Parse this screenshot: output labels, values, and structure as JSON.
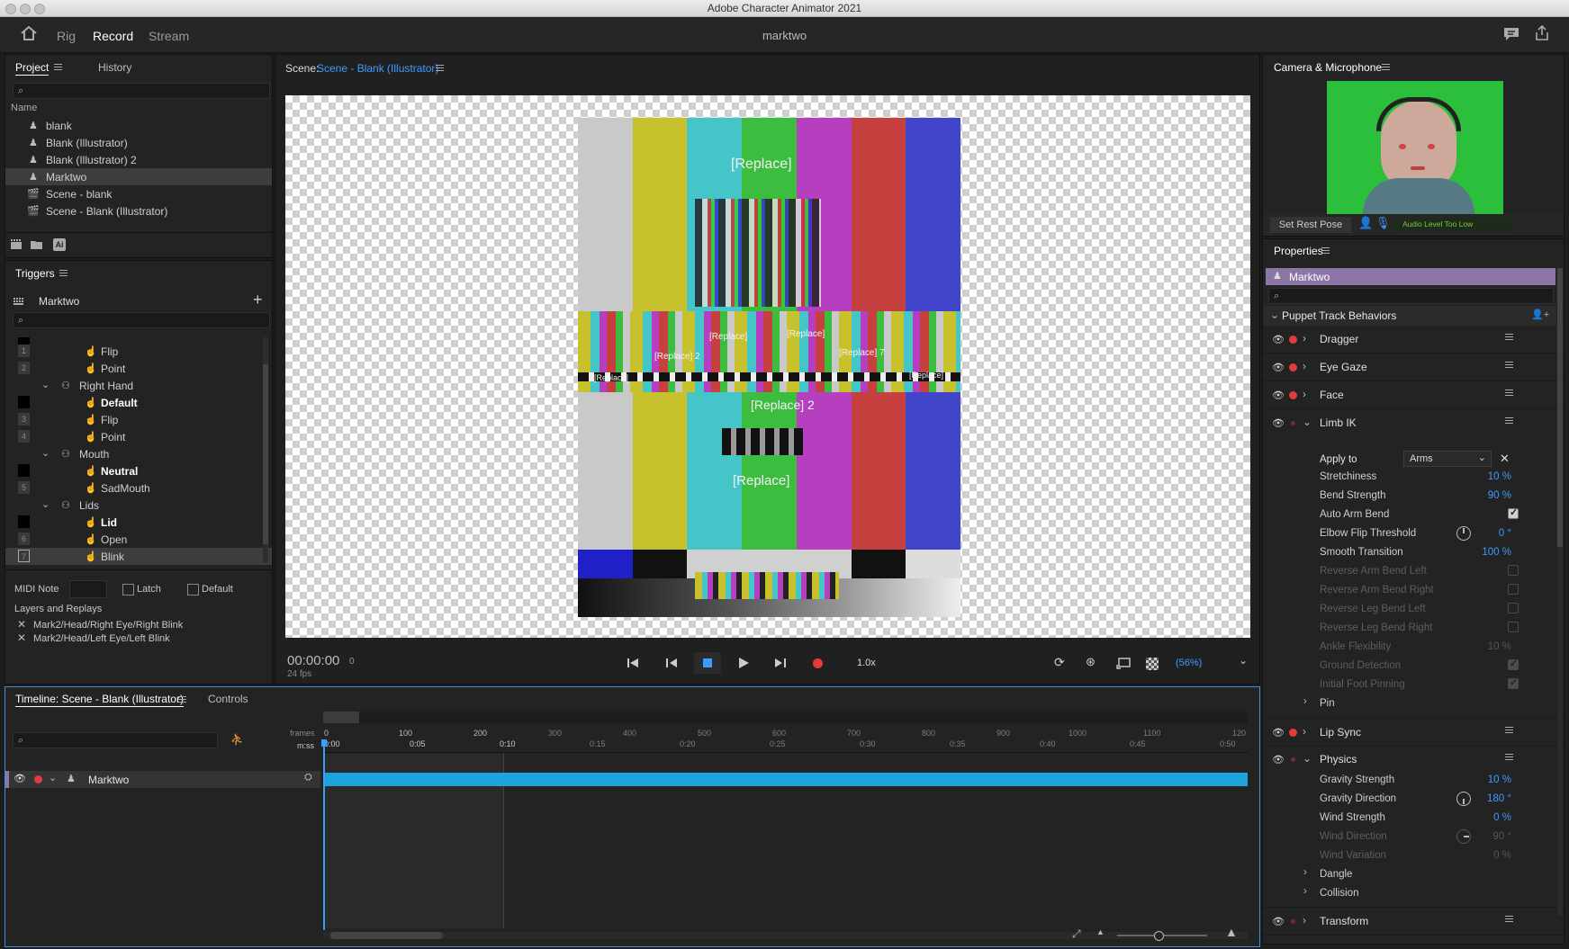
{
  "window": {
    "title": "Adobe Character Animator 2021"
  },
  "modes": {
    "rig": "Rig",
    "record": "Record",
    "stream": "Stream",
    "document_title": "marktwo"
  },
  "project": {
    "tab_project": "Project",
    "tab_history": "History",
    "col_name": "Name",
    "items": [
      "blank",
      "Blank (Illustrator)",
      "Blank (Illustrator) 2",
      "Marktwo",
      "Scene - blank",
      "Scene - Blank (Illustrator)"
    ],
    "ai_badge": "Ai"
  },
  "triggers": {
    "title": "Triggers",
    "puppet": "Marktwo",
    "rows": [
      {
        "num": "1",
        "label": "Flip"
      },
      {
        "num": "2",
        "label": "Point"
      },
      {
        "num": "",
        "label": "Right Hand"
      },
      {
        "num": "",
        "label": "Default"
      },
      {
        "num": "3",
        "label": "Flip"
      },
      {
        "num": "4",
        "label": "Point"
      },
      {
        "num": "",
        "label": "Mouth"
      },
      {
        "num": "",
        "label": "Neutral"
      },
      {
        "num": "5",
        "label": "SadMouth"
      },
      {
        "num": "",
        "label": "Lids"
      },
      {
        "num": "",
        "label": "Lid"
      },
      {
        "num": "6",
        "label": "Open"
      },
      {
        "num": "7",
        "label": "Blink"
      }
    ],
    "midi_note": "MIDI Note",
    "latch": "Latch",
    "default": "Default",
    "layers_title": "Layers and Replays",
    "layers": [
      "Mark2/Head/Right Eye/Right Blink",
      "Mark2/Head/Left Eye/Left Blink"
    ]
  },
  "scene": {
    "label": "Scene:",
    "name": "Scene - Blank (Illustrator)",
    "replace_labels": [
      "[Replace]",
      "[Replace] 2",
      "[Replace]",
      "[Replace]",
      "[Replace]",
      "[Replace] 2",
      "[Replace] 7",
      "[Replace]",
      "[Replace]"
    ],
    "timecode": "00:00:00",
    "frame": "0",
    "fps": "24 fps",
    "speed": "1.0x",
    "zoom": "(56%)"
  },
  "camera": {
    "title": "Camera & Microphone",
    "rest_pose": "Set Rest Pose",
    "audio_status": "Audio Level Too Low"
  },
  "properties": {
    "title": "Properties",
    "puppet": "Marktwo",
    "section": "Puppet Track Behaviors",
    "behaviors_top": [
      "Dragger",
      "Eye Gaze",
      "Face"
    ],
    "limb_ik": {
      "name": "Limb IK",
      "apply_to_label": "Apply to",
      "apply_to_value": "Arms",
      "rows": [
        {
          "name": "Stretchiness",
          "value": "10 %"
        },
        {
          "name": "Bend Strength",
          "value": "90 %"
        },
        {
          "name": "Auto Arm Bend",
          "value": ""
        },
        {
          "name": "Elbow Flip Threshold",
          "value": "0 °"
        },
        {
          "name": "Smooth Transition",
          "value": "100 %"
        },
        {
          "name": "Reverse Arm Bend Left",
          "value": ""
        },
        {
          "name": "Reverse Arm Bend Right",
          "value": ""
        },
        {
          "name": "Reverse Leg Bend Left",
          "value": ""
        },
        {
          "name": "Reverse Leg Bend Right",
          "value": ""
        },
        {
          "name": "Ankle Flexibility",
          "value": "10 %"
        },
        {
          "name": "Ground Detection",
          "value": ""
        },
        {
          "name": "Initial Foot Pinning",
          "value": ""
        }
      ],
      "pin": "Pin"
    },
    "lip_sync": "Lip Sync",
    "physics": {
      "name": "Physics",
      "rows": [
        {
          "name": "Gravity Strength",
          "value": "10 %"
        },
        {
          "name": "Gravity Direction",
          "value": "180 °"
        },
        {
          "name": "Wind Strength",
          "value": "0 %"
        },
        {
          "name": "Wind Direction",
          "value": "90 °"
        },
        {
          "name": "Wind Variation",
          "value": "0 %"
        }
      ],
      "dangle": "Dangle",
      "collision": "Collision"
    },
    "transform": "Transform"
  },
  "timeline": {
    "tab": "Timeline: Scene - Blank (Illustrator)",
    "tab_controls": "Controls",
    "frames_label": "frames",
    "mss_label": "m:ss",
    "frame_ticks": [
      "0",
      "100",
      "200",
      "300",
      "400",
      "500",
      "600",
      "700",
      "800",
      "900",
      "1000",
      "1100",
      "120"
    ],
    "time_ticks": [
      "0:00",
      "0:05",
      "0:10",
      "0:15",
      "0:20",
      "0:25",
      "0:30",
      "0:35",
      "0:40",
      "0:45",
      "0:50"
    ],
    "track": "Marktwo"
  },
  "colors": {
    "accent_blue": "#3d9bff",
    "track_bar": "#1fa3dc",
    "purple_header": "#8d75a8",
    "record_red": "#e33b3b",
    "green_screen": "#2bbf3c"
  }
}
